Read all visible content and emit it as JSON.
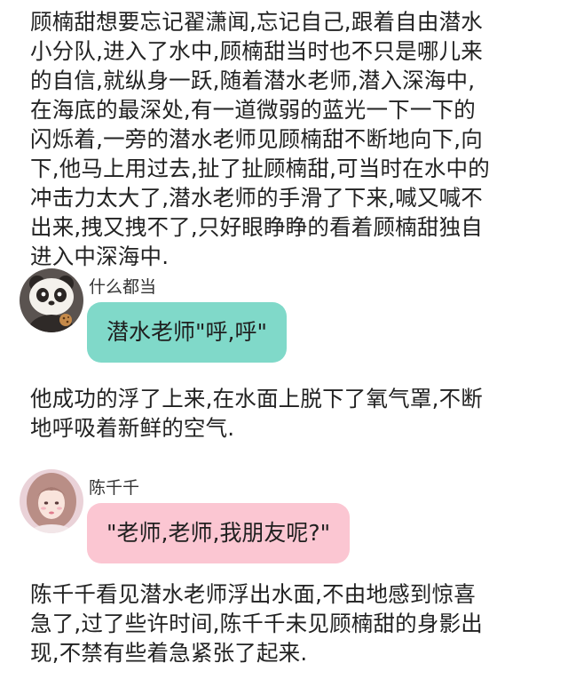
{
  "story": {
    "paragraph_1": "顾楠甜想要忘记翟潇闻,忘记自己,跟着自由潜水\n小分队,进入了水中,顾楠甜当时也不只是哪儿来\n的自信,就纵身一跃,随着潜水老师,潜入深海中,\n在海底的最深处,有一道微弱的蓝光一下一下的\n闪烁着,一旁的潜水老师见顾楠甜不断地向下,向\n下,他马上用过去,扯了扯顾楠甜,可当时在水中的\n冲击力太大了,潜水老师的手滑了下来,喊又喊不\n出来,拽又拽不了,只好眼睁睁的看着顾楠甜独自\n进入中深海中.",
    "paragraph_2": "他成功的浮了上来,在水面上脱下了氧气罩,不断\n地呼吸着新鲜的空气.",
    "paragraph_3": "陈千千看见潜水老师浮出水面,不由地感到惊喜\n急了,过了些许时间,陈千千未见顾楠甜的身影出\n现,不禁有些着急紧张了起来."
  },
  "messages": [
    {
      "username": "什么都当",
      "text": "潜水老师\"呼,呼\"",
      "bubble_color": "#80d9c9",
      "avatar": "panda-bear-avatar"
    },
    {
      "username": "陈千千",
      "text": "\"老师,老师,我朋友呢?\"",
      "bubble_color": "#fbc6d2",
      "avatar": "girl-portrait-avatar"
    }
  ]
}
